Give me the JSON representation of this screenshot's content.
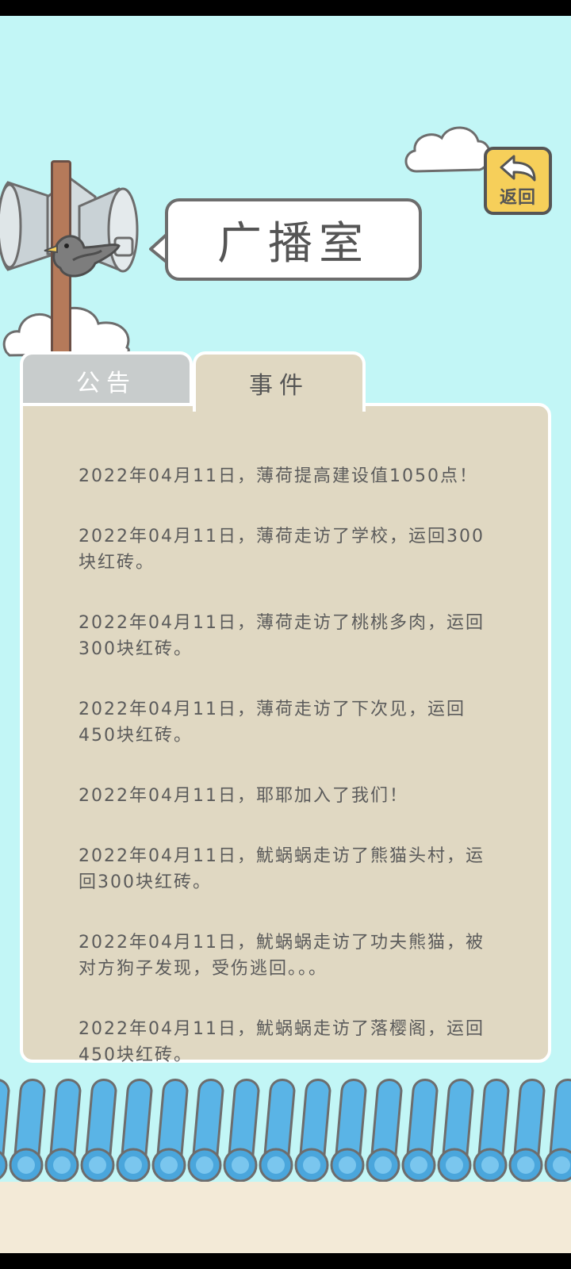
{
  "screen": {
    "title": "广播室",
    "back_button_label": "返回",
    "back_icon": "back-arrow-icon"
  },
  "tabs": [
    {
      "label": "公告",
      "active": false
    },
    {
      "label": "事件",
      "active": true
    }
  ],
  "events": [
    "2022年04月11日，薄荷提高建设值1050点！",
    "2022年04月11日，薄荷走访了学校，运回300块红砖。",
    "2022年04月11日，薄荷走访了桃桃多肉，运回300块红砖。",
    "2022年04月11日，薄荷走访了下次见，运回450块红砖。",
    "2022年04月11日，耶耶加入了我们！",
    "2022年04月11日，魷蜗蜗走访了熊猫头村，运回300块红砖。",
    "2022年04月11日，魷蜗蜗走访了功夫熊猫，被对方狗子发现，受伤逃回。。。",
    "2022年04月11日，魷蜗蜗走访了落樱阁，运回450块红砖。"
  ],
  "colors": {
    "sky": "#c2f6f6",
    "panel": "#e0d8c2",
    "inactive_tab": "#c8cccc",
    "back_button": "#f6cf5a",
    "roof_tile": "#5ab4e6",
    "ground": "#f3ead7"
  }
}
